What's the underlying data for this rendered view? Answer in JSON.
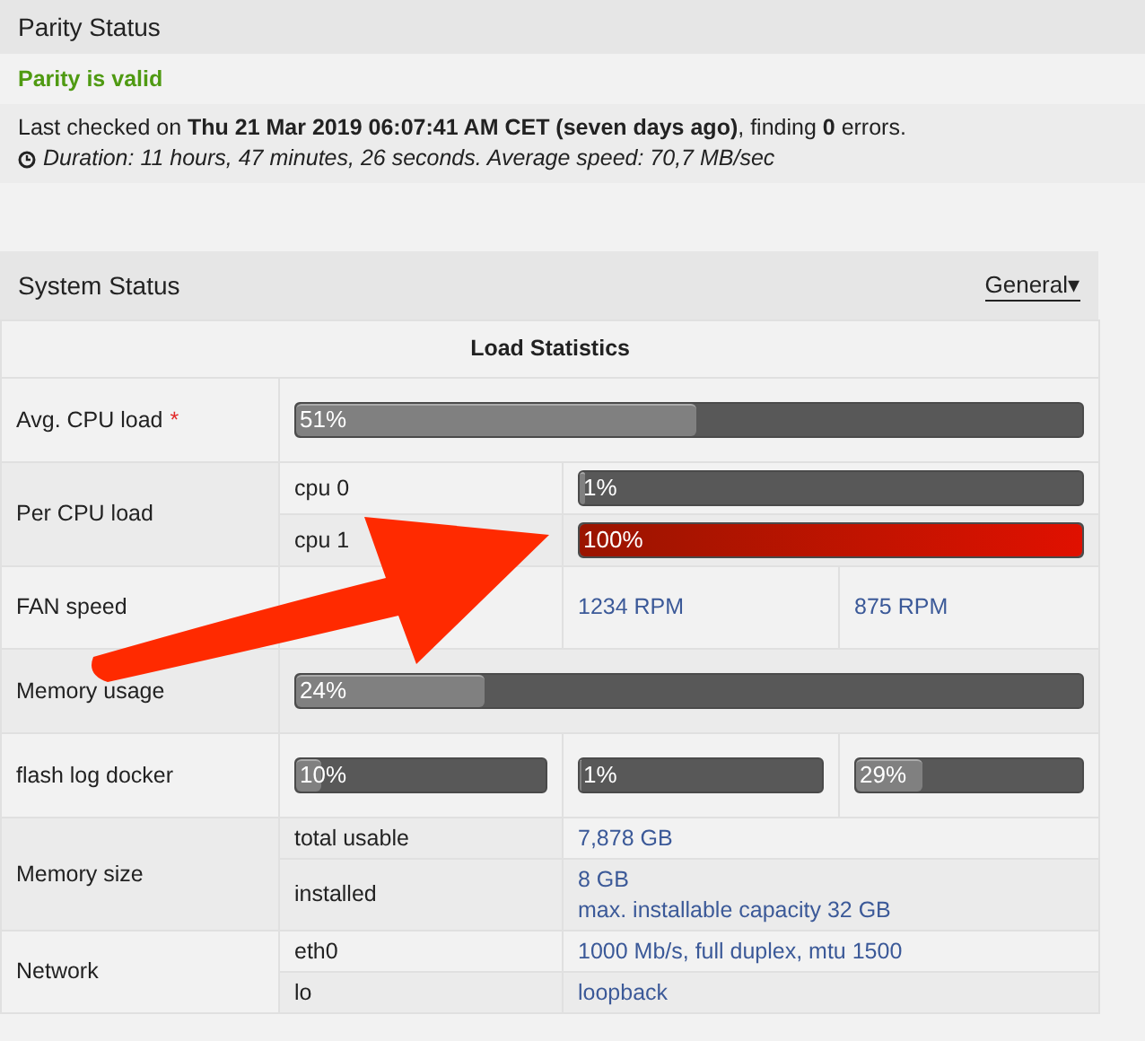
{
  "parity": {
    "title": "Parity Status",
    "status": "Parity is valid",
    "valid": true,
    "last_checked": "Last checked on **Thu 21 Mar 2019 06:07:41 AM CET (seven days ago)**, finding **0** errors.",
    "duration": "Duration: 11 hours, 47 minutes, 26 seconds. Average speed: 70,7 MB/sec"
  },
  "system": {
    "title": "System Status",
    "view_menu": "General",
    "view_caret": "▾",
    "section": "Load Statistics",
    "rows": [
      {
        "kind": "bars",
        "label": "Avg. CPU load",
        "note": "*",
        "bars": [
          {
            "level": 0.51,
            "text": "51%",
            "alert": false
          }
        ]
      },
      {
        "kind": "sub-bars",
        "label": "Per CPU load",
        "items": [
          {
            "label": "cpu 0",
            "level": 0.01,
            "text": "1%",
            "alert": false
          },
          {
            "label": "cpu 1",
            "level": 1,
            "text": "100%",
            "alert": true
          }
        ]
      },
      {
        "kind": "values",
        "label": "FAN speed",
        "values": [
          "1234 RPM",
          "875 RPM"
        ]
      },
      {
        "kind": "bars",
        "label": "Memory usage",
        "bars": [
          {
            "level": 0.24,
            "text": "24%",
            "alert": false
          }
        ]
      },
      {
        "kind": "bars",
        "label": "flash log docker",
        "bars": [
          {
            "level": 0.1,
            "text": "10%",
            "alert": false
          },
          {
            "level": 0.01,
            "text": "1%",
            "alert": false
          },
          {
            "level": 0.29,
            "text": "29%",
            "alert": false
          }
        ]
      },
      {
        "kind": "sub-values",
        "label": "Memory size",
        "items": [
          {
            "label": "total usable",
            "lines": [
              "7,878 GB"
            ]
          },
          {
            "label": "installed",
            "lines": [
              "8 GB",
              "max. installable capacity 32 GB"
            ]
          }
        ]
      },
      {
        "kind": "sub-values",
        "label": "Network",
        "items": [
          {
            "label": "eth0",
            "lines": [
              "1000 Mb/s, full duplex, mtu 1500"
            ]
          },
          {
            "label": "lo",
            "lines": [
              "loopback"
            ]
          }
        ]
      }
    ]
  }
}
